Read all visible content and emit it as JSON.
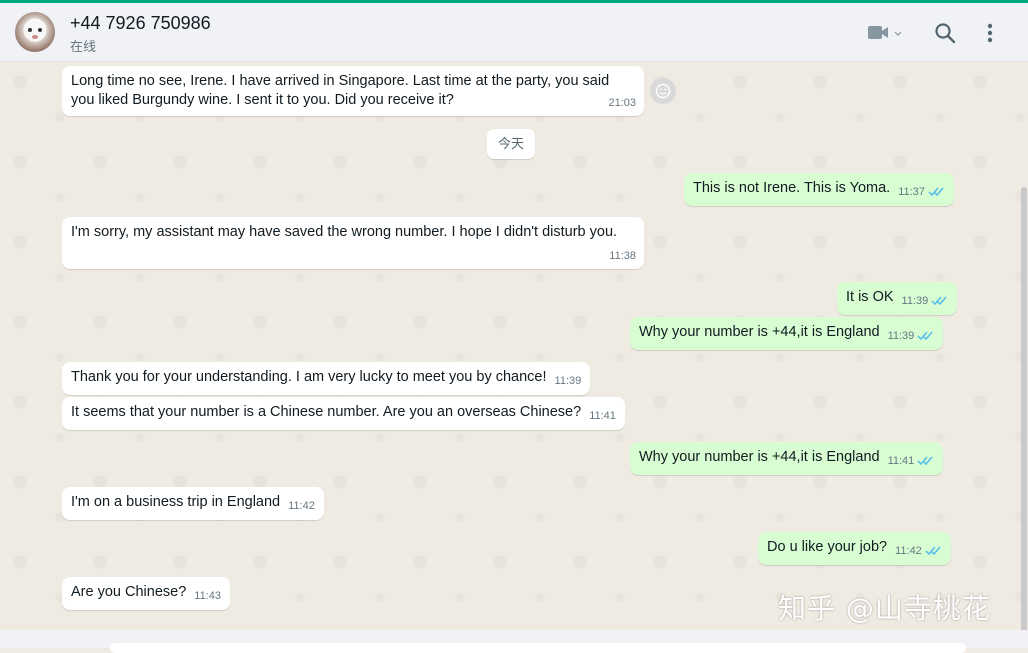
{
  "header": {
    "contact_name": "+44 7926 750986",
    "status": "在线",
    "icons": [
      "video-icon",
      "search-icon",
      "menu-icon"
    ]
  },
  "date_chip": "今天",
  "messages": [
    {
      "dir": "in",
      "text": "Long time no see, Irene. I have arrived in Singapore. Last time at the party, you said you liked Burgundy wine. I sent it to you. Did you receive it?",
      "time": "21:03"
    },
    {
      "dir": "out",
      "text": "This is not Irene. This is Yoma.",
      "time": "11:37",
      "read": true
    },
    {
      "dir": "in",
      "text": "I'm sorry, my assistant may have saved the wrong number. I hope I didn't disturb you.",
      "time": "11:38"
    },
    {
      "dir": "out",
      "text": "It is OK",
      "time": "11:39",
      "read": true
    },
    {
      "dir": "out",
      "text": "Why your number is +44,it is England",
      "time": "11:39",
      "read": true
    },
    {
      "dir": "in",
      "text": "Thank you for your understanding. I am very lucky to meet you by chance!",
      "time": "11:39"
    },
    {
      "dir": "in",
      "text": "It seems that your number is a Chinese number. Are you an overseas Chinese?",
      "time": "11:41"
    },
    {
      "dir": "out",
      "text": "Why your number is +44,it is England",
      "time": "11:41",
      "read": true
    },
    {
      "dir": "in",
      "text": "I'm on a business trip in England",
      "time": "11:42"
    },
    {
      "dir": "out",
      "text": "Do u like your job?",
      "time": "11:42",
      "read": true
    },
    {
      "dir": "in",
      "text": "Are you Chinese?",
      "time": "11:43"
    }
  ],
  "watermark": "知乎 @山寺桃花",
  "colors": {
    "accent": "#00a884",
    "outgoing": "#d9fdd3",
    "incoming": "#ffffff",
    "read_ticks": "#53bdeb"
  }
}
